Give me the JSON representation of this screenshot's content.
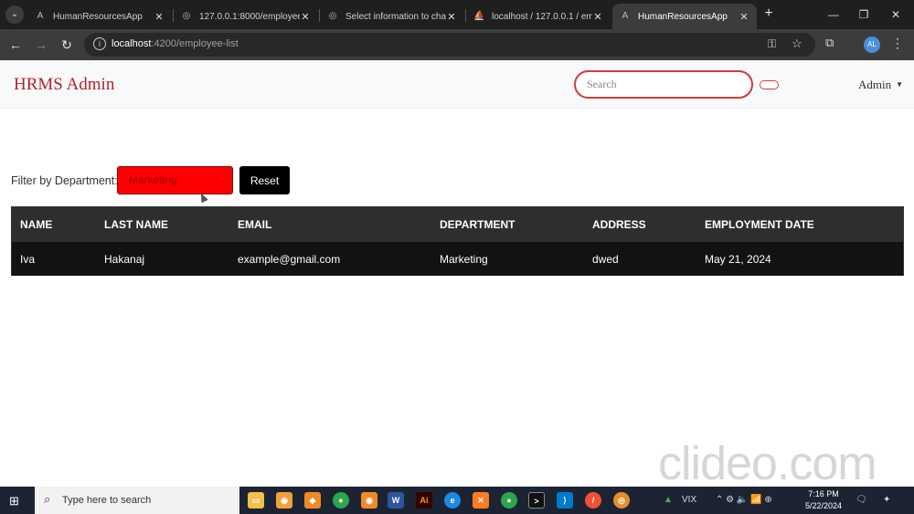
{
  "browser": {
    "tabs": [
      {
        "title": "HumanResourcesApp",
        "icon": "angular-icon",
        "active": false
      },
      {
        "title": "127.0.0.1:8000/employee",
        "icon": "globe-icon",
        "active": false
      },
      {
        "title": "Select information to cha",
        "icon": "globe-icon",
        "active": false
      },
      {
        "title": "localhost / 127.0.0.1 / em",
        "icon": "phpmyadmin-icon",
        "active": false
      },
      {
        "title": "HumanResourcesApp",
        "icon": "angular-icon",
        "active": true
      }
    ],
    "url_host": "localhost",
    "url_path": ":4200/employee-list",
    "profile_initials": "AL"
  },
  "app": {
    "brand": "HRMS Admin",
    "search_placeholder": "Search",
    "user_menu": "Admin"
  },
  "filter": {
    "label": "Filter by Department:",
    "selected": "Marketing",
    "reset_label": "Reset",
    "select_color": "#ff0000"
  },
  "table": {
    "headers": [
      "NAME",
      "LAST NAME",
      "EMAIL",
      "DEPARTMENT",
      "ADDRESS",
      "EMPLOYMENT DATE"
    ],
    "rows": [
      [
        "Iva",
        "Hakanaj",
        "example@gmail.com",
        "Marketing",
        "dwed",
        "May 21, 2024"
      ]
    ]
  },
  "watermark": "clideo.com",
  "taskbar": {
    "search_placeholder": "Type here to search",
    "stock_label": "VIX",
    "time": "7:16 PM",
    "date": "5/22/2024"
  }
}
